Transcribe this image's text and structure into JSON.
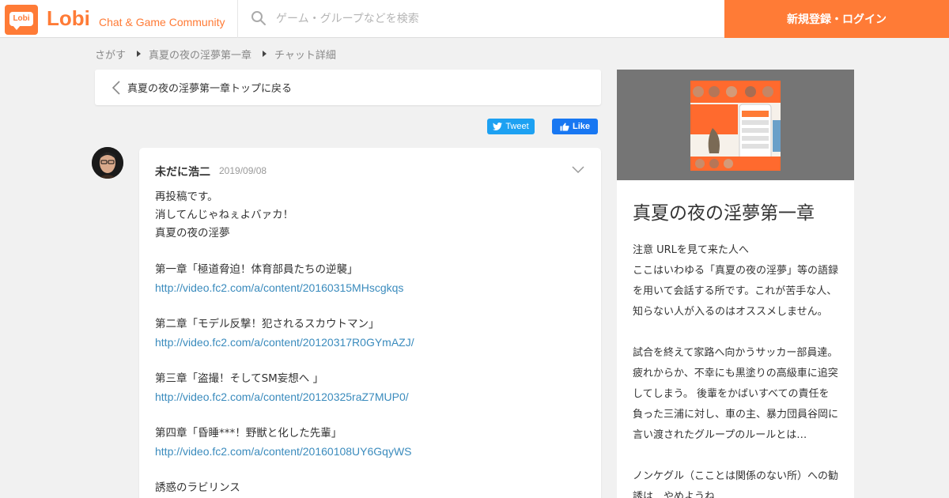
{
  "header": {
    "logo_text": "Lobi",
    "brand": "Lobi",
    "brand_sub": "Chat & Game Community",
    "search_placeholder": "ゲーム・グループなどを検索",
    "login_label": "新規登録・ログイン"
  },
  "breadcrumb": [
    "さがす",
    "真夏の夜の淫夢第一章",
    "チャット詳細"
  ],
  "back_link": "真夏の夜の淫夢第一章トップに戻る",
  "social": {
    "tweet": "Tweet",
    "like": "Like"
  },
  "post": {
    "author": "未だに浩二",
    "date": "2019/09/08",
    "lines": [
      "再投稿です。",
      "消してんじゃねぇよバァカ！",
      "真夏の夜の淫夢",
      "",
      "第一章「極道脅迫！体育部員たちの逆襲」",
      "http://video.fc2.com/a/content/20160315MHscgkqs",
      "",
      "第二章「モデル反撃！犯されるスカウトマン」",
      "http://video.fc2.com/a/content/20120317R0GYmAZJ/",
      "",
      "第三章「盗撮！そしてSM妄想へ 」",
      "http://video.fc2.com/a/content/20120325raZ7MUP0/",
      "",
      "第四章「昏睡***！野獣と化した先輩」",
      "http://video.fc2.com/a/content/20160108UY6GqyWS",
      "",
      "誘惑のラビリンス"
    ]
  },
  "sidebar": {
    "title": "真夏の夜の淫夢第一章",
    "desc_lines": [
      "注意 URLを見て来た人へ",
      "ここはいわゆる「真夏の夜の淫夢」等の語録",
      "を用いて会話する所です。これが苦手な人、",
      "知らない人が入るのはオススメしません。",
      "",
      "試合を終えて家路へ向かうサッカー部員達。",
      "疲れからか、不幸にも黒塗りの高級車に追突",
      "してしまう。 後輩をかばいすべての責任を",
      "負った三浦に対し、車の主、暴力団員谷岡に",
      "言い渡されたグループのルールとは…",
      "",
      "ノンケグル（こことは関係のない所）への勧",
      "誘は…やめようね"
    ]
  },
  "colors": {
    "brand": "#ff7b36",
    "link": "#3a8bbd",
    "tweet": "#1da1f2",
    "like": "#1877f2"
  }
}
